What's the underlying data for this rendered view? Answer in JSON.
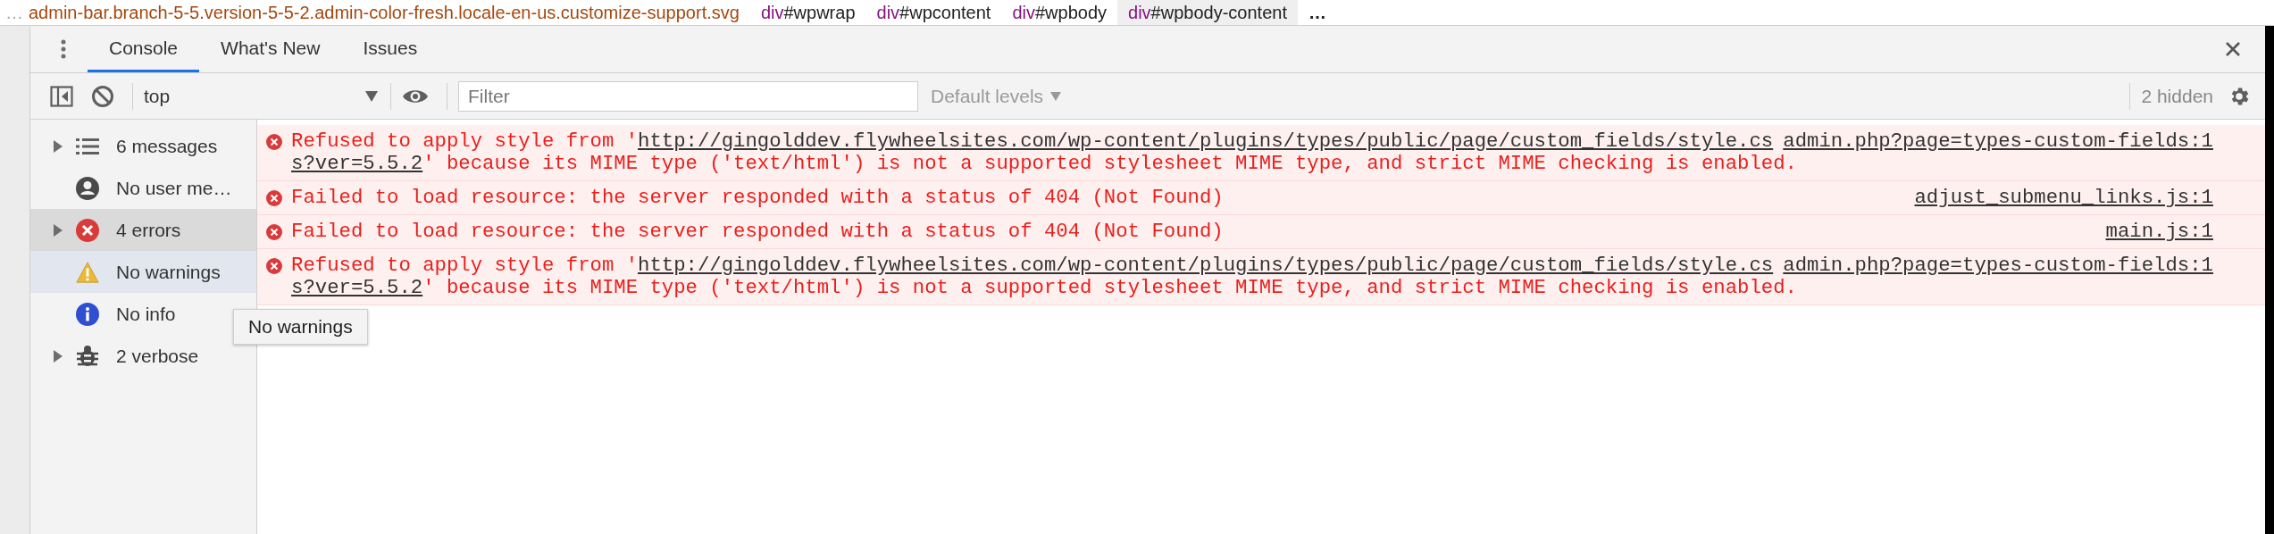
{
  "breadcrumbs": [
    {
      "kind": "ellipsis",
      "text": "…",
      "dim": true
    },
    {
      "kind": "class",
      "text": "admin-bar.branch-5-5.version-5-5-2.admin-color-fresh.locale-en-us.customize-support.svg"
    },
    {
      "kind": "element",
      "tag": "div",
      "id": "#wpwrap",
      "selected": false
    },
    {
      "kind": "element",
      "tag": "div",
      "id": "#wpcontent",
      "selected": false
    },
    {
      "kind": "element",
      "tag": "div",
      "id": "#wpbody",
      "selected": false
    },
    {
      "kind": "element",
      "tag": "div",
      "id": "#wpbody-content",
      "selected": true
    },
    {
      "kind": "ellipsis",
      "text": "…",
      "dim": false
    }
  ],
  "tabs": [
    {
      "label": "Console",
      "selected": true
    },
    {
      "label": "What's New",
      "selected": false
    },
    {
      "label": "Issues",
      "selected": false
    }
  ],
  "toolbar": {
    "context": "top",
    "filter": {
      "placeholder": "Filter"
    },
    "levels": "Default levels",
    "hidden": "2 hidden"
  },
  "sidebar": {
    "items": [
      {
        "kind": "messages",
        "label": "6 messages",
        "expandable": true,
        "selected": false,
        "hovered": false
      },
      {
        "kind": "user",
        "label": "No user me…",
        "expandable": false,
        "selected": false,
        "hovered": false
      },
      {
        "kind": "error",
        "label": "4 errors",
        "expandable": true,
        "selected": true,
        "hovered": false
      },
      {
        "kind": "warning",
        "label": "No warnings",
        "expandable": false,
        "selected": false,
        "hovered": true
      },
      {
        "kind": "info",
        "label": "No info",
        "expandable": false,
        "selected": false,
        "hovered": false
      },
      {
        "kind": "verbose",
        "label": "2 verbose",
        "expandable": true,
        "selected": false,
        "hovered": false
      }
    ]
  },
  "tooltip": "No warnings",
  "messages": [
    {
      "kind": "error",
      "lines": [
        [
          {
            "text": "Refused to apply style from '"
          },
          {
            "link": "http://gingolddev.flywheelsites.com/wp-content/plugins/types/public/page/custom_fields/style.cs"
          }
        ],
        [
          {
            "link": "s?ver=5.5.2"
          },
          {
            "text": "' because its MIME type ('text/html') is not a supported stylesheet MIME type, and strict MIME checking is enabled."
          }
        ]
      ],
      "source": "admin.php?page=types-custom-fields:1"
    },
    {
      "kind": "error",
      "lines": [
        [
          {
            "text": "Failed to load resource: the server responded with a status of 404 (Not Found)"
          }
        ]
      ],
      "source": "adjust_submenu_links.js:1"
    },
    {
      "kind": "error",
      "lines": [
        [
          {
            "text": "Failed to load resource: the server responded with a status of 404 (Not Found)"
          }
        ]
      ],
      "source": "main.js:1"
    },
    {
      "kind": "error",
      "lines": [
        [
          {
            "text": "Refused to apply style from '"
          },
          {
            "link": "http://gingolddev.flywheelsites.com/wp-content/plugins/types/public/page/custom_fields/style.cs"
          }
        ],
        [
          {
            "link": "s?ver=5.5.2"
          },
          {
            "text": "' because its MIME type ('text/html') is not a supported stylesheet MIME type, and strict MIME checking is enabled."
          }
        ]
      ],
      "source": "admin.php?page=types-custom-fields:1"
    }
  ]
}
